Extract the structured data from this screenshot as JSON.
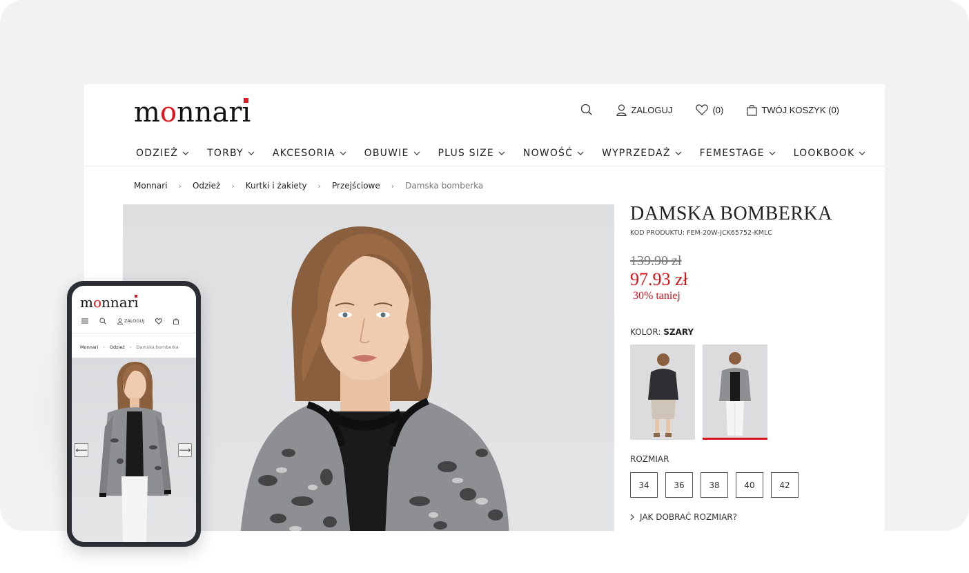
{
  "brand": {
    "logo_part1": "m",
    "logo_o": "o",
    "logo_part2": "nnar",
    "logo_i": "ı",
    "accent": "#e0161c"
  },
  "header": {
    "search_icon": "search-icon",
    "login_label": "ZALOGUJ",
    "wishlist_count": "(0)",
    "cart_label": "TWÓJ KOSZYK (0)"
  },
  "nav": {
    "items": [
      {
        "label": "ODZIEŻ"
      },
      {
        "label": "TORBY"
      },
      {
        "label": "AKCESORIA"
      },
      {
        "label": "OBUWIE"
      },
      {
        "label": "PLUS SIZE"
      },
      {
        "label": "NOWOŚĆ"
      },
      {
        "label": "WYPRZEDAŻ"
      },
      {
        "label": "FEMESTAGE"
      },
      {
        "label": "LOOKBOOK"
      }
    ]
  },
  "breadcrumb": {
    "items": [
      "Monnari",
      "Odzież",
      "Kurtki i żakiety",
      "Przejściowe"
    ],
    "current": "Damska bomberka"
  },
  "product": {
    "title": "DAMSKA BOMBERKA",
    "code": "KOD PRODUKTU: FEM-20W-JCK65752-KMLC",
    "old_price": "139.90 zł",
    "new_price": "97.93 zł",
    "discount": "30% taniej",
    "color_label": "KOLOR:",
    "color_value": "SZARY",
    "size_label": "ROZMIAR",
    "sizes": [
      "34",
      "36",
      "38",
      "40",
      "42"
    ],
    "size_guide": "JAK DOBRAĆ ROZMIAR?",
    "price_color": "#d4131b"
  },
  "mobile": {
    "login_label": "ZALOGUJ",
    "breadcrumb": [
      "Monnari",
      "Odzież"
    ],
    "breadcrumb_current": "Damska bomberka",
    "arrow_left": "⟵",
    "arrow_right": "⟶"
  }
}
